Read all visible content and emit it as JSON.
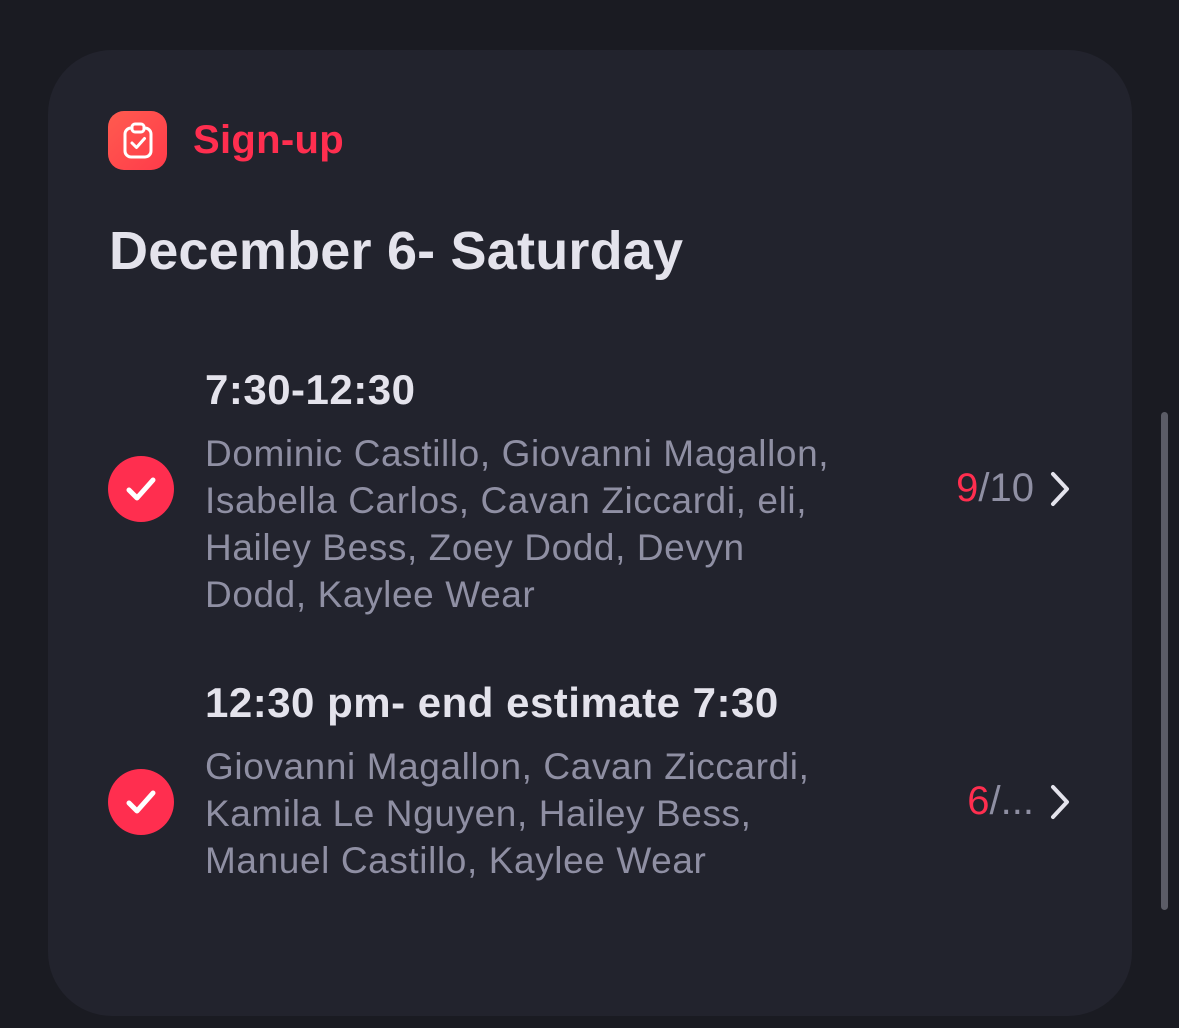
{
  "app": {
    "title": "Sign-up",
    "icon": "clipboard-check-icon",
    "accent_color": "#ff2e4f"
  },
  "date_title": "December 6- Saturday",
  "slots": [
    {
      "time": "7:30-12:30",
      "names": "Dominic Castillo, Giovanni Magallon, Isabella Carlos, Cavan Ziccardi, eli, Hailey Bess, Zoey Dodd, Devyn Dodd, Kaylee Wear",
      "filled": "9",
      "capacity": "/10",
      "checked": true
    },
    {
      "time": "12:30 pm- end estimate 7:30",
      "names": "Giovanni Magallon, Cavan Ziccardi, Kamila Le Nguyen, Hailey Bess, Manuel Castillo, Kaylee Wear",
      "filled": "6",
      "capacity": "/...",
      "checked": true
    }
  ]
}
